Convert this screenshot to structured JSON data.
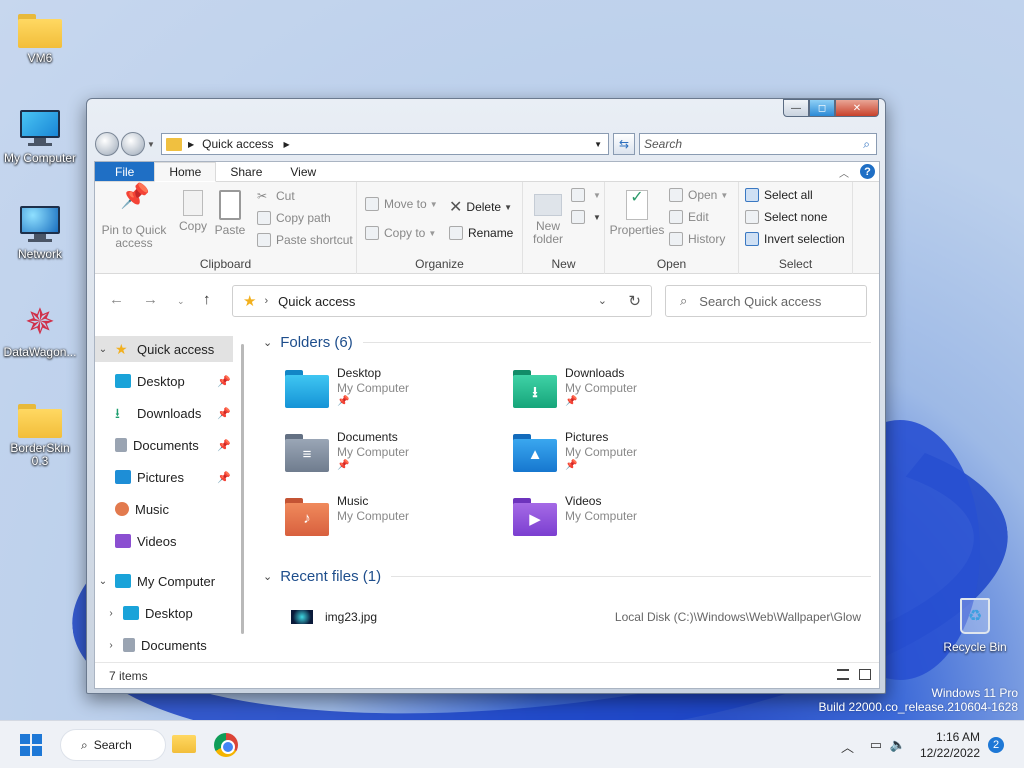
{
  "desktop": {
    "icons": [
      {
        "label": "VM6"
      },
      {
        "label": "My Computer"
      },
      {
        "label": "Network"
      },
      {
        "label": "DataWagon..."
      },
      {
        "label": "BorderSkin 0.3"
      }
    ],
    "recycle_label": "Recycle Bin",
    "watermark_line1": "Windows 11 Pro",
    "watermark_line2": "Build 22000.co_release.210604-1628"
  },
  "window": {
    "old_address": "Quick access",
    "old_search_placeholder": "Search",
    "caption": {
      "min": "—",
      "max": "◻",
      "close": "✕"
    }
  },
  "ribbon": {
    "tabs": [
      "File",
      "Home",
      "Share",
      "View"
    ],
    "active_tab": "Home",
    "clipboard": {
      "pin": "Pin to Quick access",
      "copy": "Copy",
      "paste": "Paste",
      "cut": "Cut",
      "copy_path": "Copy path",
      "paste_shortcut": "Paste shortcut",
      "label": "Clipboard"
    },
    "organize": {
      "move_to": "Move to",
      "copy_to": "Copy to",
      "delete": "Delete",
      "rename": "Rename",
      "label": "Organize"
    },
    "new": {
      "new_folder": "New folder",
      "label": "New"
    },
    "open": {
      "properties": "Properties",
      "open": "Open",
      "edit": "Edit",
      "history": "History",
      "label": "Open"
    },
    "select": {
      "select_all": "Select all",
      "select_none": "Select none",
      "invert": "Invert selection",
      "label": "Select"
    }
  },
  "address": {
    "path": "Quick access",
    "search_placeholder": "Search Quick access"
  },
  "nav": {
    "quick_access": "Quick access",
    "items": [
      "Desktop",
      "Downloads",
      "Documents",
      "Pictures",
      "Music",
      "Videos"
    ],
    "my_computer": "My Computer",
    "sub_items": [
      "Desktop",
      "Documents"
    ]
  },
  "content": {
    "folders_header": "Folders (6)",
    "folders": [
      {
        "name": "Desktop",
        "location": "My Computer"
      },
      {
        "name": "Downloads",
        "location": "My Computer"
      },
      {
        "name": "Documents",
        "location": "My Computer"
      },
      {
        "name": "Pictures",
        "location": "My Computer"
      },
      {
        "name": "Music",
        "location": "My Computer"
      },
      {
        "name": "Videos",
        "location": "My Computer"
      }
    ],
    "recent_header": "Recent files (1)",
    "recent": [
      {
        "name": "img23.jpg",
        "path": "Local Disk (C:)\\Windows\\Web\\Wallpaper\\Glow"
      }
    ]
  },
  "status": {
    "items": "7 items"
  },
  "taskbar": {
    "search": "Search",
    "time": "1:16 AM",
    "date": "12/22/2022",
    "notifications": "2"
  },
  "colors": {
    "accent": "#1f6fc5",
    "folder_yellow": "#f2be3a"
  }
}
